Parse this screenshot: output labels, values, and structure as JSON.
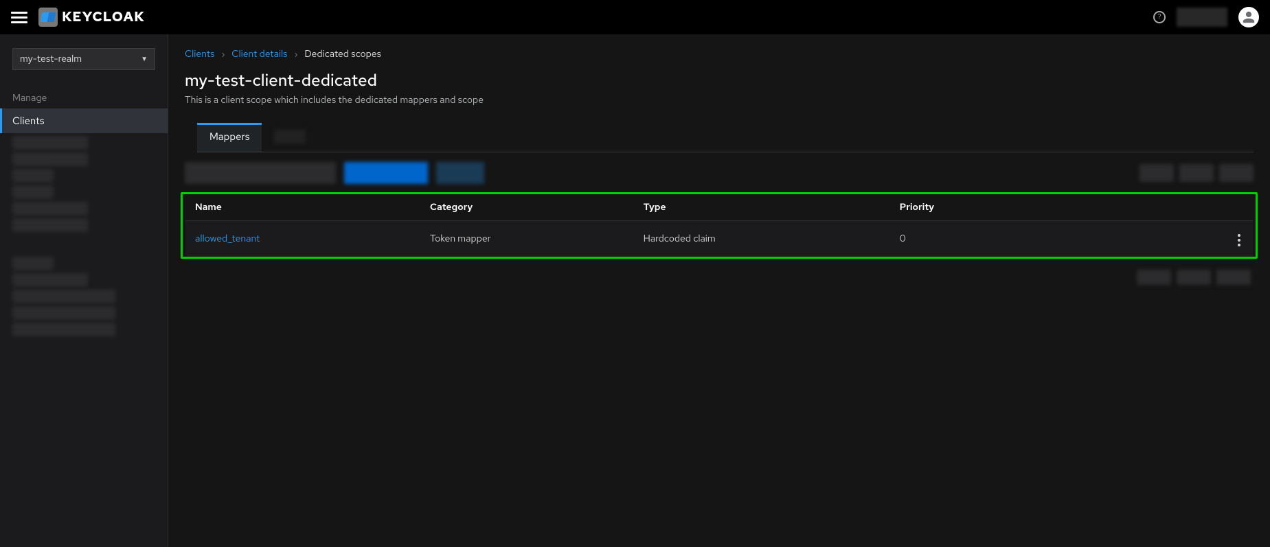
{
  "brand": "KEYCLOAK",
  "realm": {
    "selected": "my-test-realm"
  },
  "sidebar": {
    "section_manage": "Manage",
    "clients_label": "Clients"
  },
  "breadcrumbs": {
    "clients": "Clients",
    "client_details": "Client details",
    "current": "Dedicated scopes"
  },
  "page": {
    "title": "my-test-client-dedicated",
    "description": "This is a client scope which includes the dedicated mappers and scope"
  },
  "tabs": {
    "mappers": "Mappers"
  },
  "table": {
    "headers": {
      "name": "Name",
      "category": "Category",
      "type": "Type",
      "priority": "Priority"
    },
    "rows": [
      {
        "name": "allowed_tenant",
        "category": "Token mapper",
        "type": "Hardcoded claim",
        "priority": "0"
      }
    ]
  }
}
